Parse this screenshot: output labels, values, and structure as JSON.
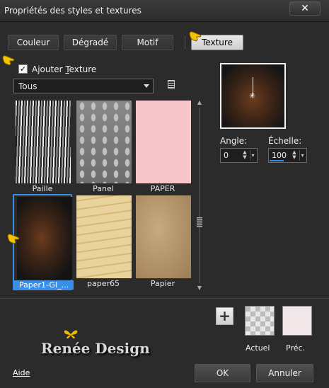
{
  "window": {
    "title": "Propriétés des styles et textures",
    "close_label": "✕"
  },
  "tabs": [
    {
      "label": "Couleur"
    },
    {
      "label": "Dégradé"
    },
    {
      "label": "Motif"
    },
    {
      "label": "Texture"
    }
  ],
  "texture": {
    "add_label": "Ajouter Texture",
    "add_checked": true,
    "category": "Tous",
    "items": [
      {
        "label": "Paille"
      },
      {
        "label": "Panel"
      },
      {
        "label": "PAPER"
      },
      {
        "label": "Paper1-GI_..."
      },
      {
        "label": "paper65"
      },
      {
        "label": "Papier"
      }
    ]
  },
  "angle": {
    "label": "Angle:",
    "value": "0"
  },
  "scale": {
    "label": "Échelle:",
    "value": "100"
  },
  "swatches": {
    "current_label": "Actuel",
    "previous_label": "Préc."
  },
  "logo": {
    "text": "Renée Design"
  },
  "footer": {
    "help_label": "Aide",
    "ok_label": "OK",
    "cancel_label": "Annuler"
  }
}
